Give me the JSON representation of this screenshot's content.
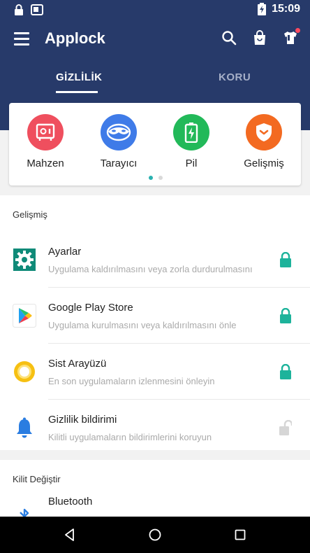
{
  "status_bar": {
    "time": "15:09",
    "icons": [
      "lock-icon",
      "gallery-icon",
      "battery-charging-icon"
    ]
  },
  "app_bar": {
    "title": "Applock",
    "icons": [
      "menu-icon",
      "search-icon",
      "shopping-bag-icon",
      "tshirt-icon"
    ]
  },
  "tabs": [
    {
      "label": "GİZLİLİK",
      "active": true
    },
    {
      "label": "KORU",
      "active": false
    }
  ],
  "features": [
    {
      "label": "Mahzen",
      "icon": "vault-icon",
      "color": "#ef4f5e"
    },
    {
      "label": "Tarayıcı",
      "icon": "mask-browser-icon",
      "color": "#3f7be8"
    },
    {
      "label": "Pil",
      "icon": "battery-icon",
      "color": "#22b959"
    },
    {
      "label": "Gelişmiş",
      "icon": "shield-icon",
      "color": "#f36a21"
    }
  ],
  "carousel": {
    "pages": 2,
    "current": 1
  },
  "advanced_section": {
    "header": "Gelişmiş",
    "items": [
      {
        "name": "Ayarlar",
        "desc": "Uygulama kaldırılmasını veya zorla durdurulmasını",
        "icon": "settings-gear-icon",
        "locked": true
      },
      {
        "name": "Google Play Store",
        "desc": "Uygulama kurulmasını veya kaldırılmasını önle",
        "icon": "play-store-icon",
        "locked": true
      },
      {
        "name": "Sist Arayüzü",
        "desc": "En son uygulamaların izlenmesini önleyin",
        "icon": "system-ui-icon",
        "locked": true
      },
      {
        "name": "Gizlilik bildirimi",
        "desc": "Kilitli uygulamaların bildirimlerini koruyun",
        "icon": "bell-icon",
        "locked": false
      }
    ]
  },
  "switch_section": {
    "header": "Kilit Değiştir",
    "items": [
      {
        "name": "Bluetooth",
        "icon": "bluetooth-icon"
      }
    ]
  },
  "colors": {
    "primary": "#273a6a",
    "accent": "#2ab1b0",
    "lock_on": "#1db39b",
    "lock_off": "#d6d6d6"
  },
  "nav_bar": {
    "icons": [
      "back-icon",
      "home-icon",
      "recents-icon"
    ]
  }
}
